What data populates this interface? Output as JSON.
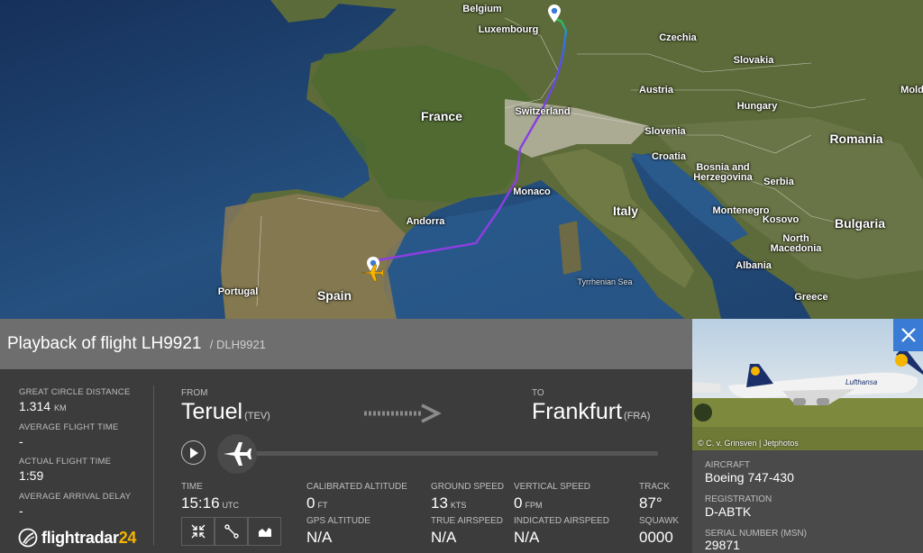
{
  "map": {
    "labels": {
      "belgium": "Belgium",
      "luxembourg": "Luxembourg",
      "czechia": "Czechia",
      "france": "France",
      "slovakia": "Slovakia",
      "austria": "Austria",
      "switzerland": "Switzerland",
      "hungary": "Hungary",
      "slovenia": "Slovenia",
      "romania": "Romania",
      "croatia": "Croatia",
      "bosnia": "Bosnia and\nHerzegovina",
      "serbia": "Serbia",
      "monaco": "Monaco",
      "italy": "Italy",
      "montenegro": "Montenegro",
      "kosovo": "Kosovo",
      "bulgaria": "Bulgaria",
      "andorra": "Andorra",
      "north_macedonia": "North\nMacedonia",
      "albania": "Albania",
      "portugal": "Portugal",
      "spain": "Spain",
      "tyrrhenian": "Tyrrhenian Sea",
      "greece": "Greece",
      "moldova": "Mold"
    },
    "route_color_start": "#8b3fe0",
    "route_color_end": "#2ecc40"
  },
  "header": {
    "title": "Playback of flight LH9921",
    "callsign": "/ DLH9921"
  },
  "stats": {
    "great_circle_label": "GREAT CIRCLE DISTANCE",
    "great_circle_value": "1.314",
    "great_circle_unit": "KM",
    "avg_flight_label": "AVERAGE FLIGHT TIME",
    "avg_flight_value": "-",
    "actual_flight_label": "ACTUAL FLIGHT TIME",
    "actual_flight_value": "1:59",
    "avg_delay_label": "AVERAGE ARRIVAL DELAY",
    "avg_delay_value": "-"
  },
  "logo": {
    "text_main": "flightradar",
    "text_accent": "24"
  },
  "route": {
    "from_label": "FROM",
    "from_city": "Teruel",
    "from_code": "(TEV)",
    "to_label": "TO",
    "to_city": "Frankfurt",
    "to_code": "(FRA)"
  },
  "details": {
    "time_label": "TIME",
    "time_value": "15:16",
    "time_unit": "UTC",
    "cal_alt_label": "CALIBRATED ALTITUDE",
    "cal_alt_value": "0",
    "cal_alt_unit": "FT",
    "gps_alt_label": "GPS ALTITUDE",
    "gps_alt_value": "N/A",
    "ground_speed_label": "GROUND SPEED",
    "ground_speed_value": "13",
    "ground_speed_unit": "KTS",
    "true_airspeed_label": "TRUE AIRSPEED",
    "true_airspeed_value": "N/A",
    "vertical_speed_label": "VERTICAL SPEED",
    "vertical_speed_value": "0",
    "vertical_speed_unit": "FPM",
    "indicated_airspeed_label": "INDICATED AIRSPEED",
    "indicated_airspeed_value": "N/A",
    "track_label": "TRACK",
    "track_value": "87°",
    "squawk_label": "SQUAWK",
    "squawk_value": "0000"
  },
  "aircraft": {
    "photo_credit": "© C. v. Grinsven | Jetphotos",
    "aircraft_label": "AIRCRAFT",
    "aircraft_value": "Boeing 747-430",
    "registration_label": "REGISTRATION",
    "registration_value": "D-ABTK",
    "serial_label": "SERIAL NUMBER (MSN)",
    "serial_value": "29871",
    "livery_text": "Lufthansa"
  }
}
